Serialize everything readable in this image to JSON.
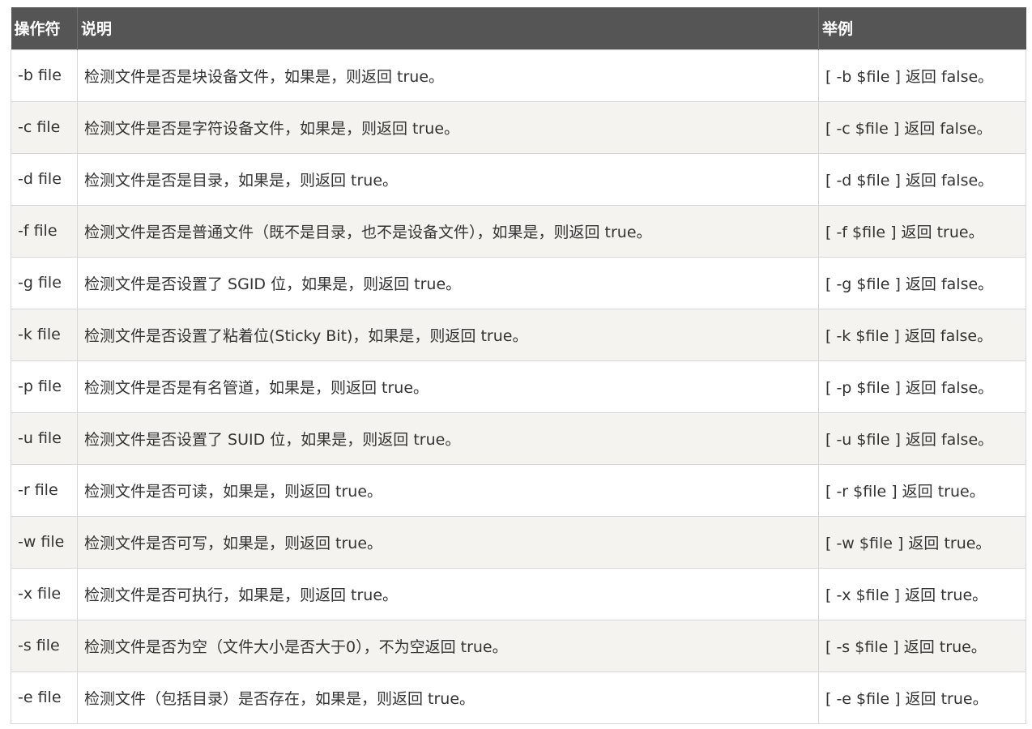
{
  "table": {
    "headers": [
      "操作符",
      "说明",
      "举例"
    ],
    "rows": [
      {
        "op": "-b file",
        "desc": "检测文件是否是块设备文件，如果是，则返回 true。",
        "example": "[ -b $file ] 返回 false。"
      },
      {
        "op": "-c file",
        "desc": "检测文件是否是字符设备文件，如果是，则返回 true。",
        "example": "[ -c $file ] 返回 false。"
      },
      {
        "op": "-d file",
        "desc": "检测文件是否是目录，如果是，则返回 true。",
        "example": "[ -d $file ] 返回 false。"
      },
      {
        "op": "-f file",
        "desc": "检测文件是否是普通文件（既不是目录，也不是设备文件），如果是，则返回 true。",
        "example": "[ -f $file ] 返回 true。"
      },
      {
        "op": "-g file",
        "desc": "检测文件是否设置了 SGID 位，如果是，则返回 true。",
        "example": "[ -g $file ] 返回 false。"
      },
      {
        "op": "-k file",
        "desc": "检测文件是否设置了粘着位(Sticky Bit)，如果是，则返回 true。",
        "example": "[ -k $file ] 返回 false。"
      },
      {
        "op": "-p file",
        "desc": "检测文件是否是有名管道，如果是，则返回 true。",
        "example": "[ -p $file ] 返回 false。"
      },
      {
        "op": "-u file",
        "desc": "检测文件是否设置了 SUID 位，如果是，则返回 true。",
        "example": "[ -u $file ] 返回 false。"
      },
      {
        "op": "-r file",
        "desc": "检测文件是否可读，如果是，则返回 true。",
        "example": "[ -r $file ] 返回 true。"
      },
      {
        "op": "-w file",
        "desc": "检测文件是否可写，如果是，则返回 true。",
        "example": "[ -w $file ] 返回 true。"
      },
      {
        "op": "-x file",
        "desc": "检测文件是否可执行，如果是，则返回 true。",
        "example": "[ -x $file ] 返回 true。"
      },
      {
        "op": "-s file",
        "desc": "检测文件是否为空（文件大小是否大于0），不为空返回 true。",
        "example": "[ -s $file ] 返回 true。"
      },
      {
        "op": "-e file",
        "desc": "检测文件（包括目录）是否存在，如果是，则返回 true。",
        "example": "[ -e $file ] 返回 true。"
      }
    ]
  },
  "colors": {
    "header_bg": "#555555",
    "header_text": "#ffffff",
    "row_alt_bg": "#f4f3f0",
    "text": "#333333",
    "border": "#d8d8d8"
  }
}
